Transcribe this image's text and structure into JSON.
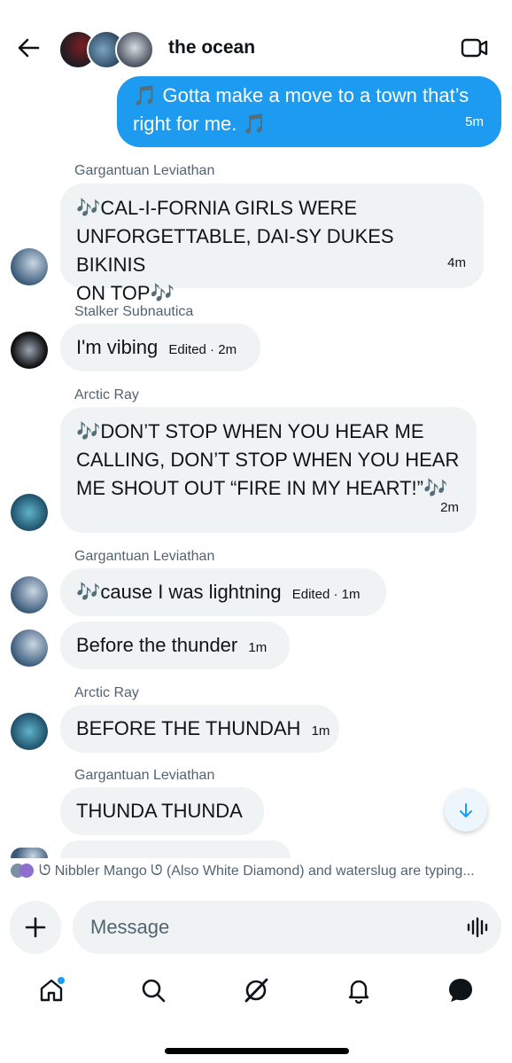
{
  "header": {
    "title": "the ocean"
  },
  "messages": [
    {
      "sender": "",
      "text": "🎵 Gotta make a move to a town that’s right for me. 🎵",
      "line1": "🎵 Gotta make a move to a town that’s",
      "line2": "right for me. 🎵",
      "time": "5m"
    },
    {
      "sender": "Gargantuan Leviathan",
      "line1": "🎶CAL-I-FORNIA GIRLS WERE",
      "line2": "UNFORGETTABLE, DAI-SY DUKES BIKINIS",
      "line3": "ON TOP🎶",
      "time": "4m"
    },
    {
      "sender": "Stalker Subnautica",
      "text": "I'm vibing",
      "time": "Edited · 2m"
    },
    {
      "sender": "Arctic Ray",
      "line1": "🎶DON’T STOP WHEN YOU HEAR ME",
      "line2": "CALLING, DON’T STOP WHEN YOU HEAR",
      "line3": "ME SHOUT OUT “FIRE IN MY HEART!”🎶",
      "time": "2m"
    },
    {
      "sender": "Gargantuan Leviathan",
      "text": "🎶cause I was lightning",
      "time": "Edited · 1m"
    },
    {
      "sender": "",
      "text": "Before the thunder",
      "time": "1m"
    },
    {
      "sender": "Arctic Ray",
      "text": "BEFORE THE THUNDAH",
      "time": "1m"
    },
    {
      "sender": "Gargantuan Leviathan",
      "text": "THUNDA THUNDA",
      "time": ""
    }
  ],
  "typing_indicator": "ᘎ Nibbler Mango ᘎ (Also White Diamond) and waterslug are typing...",
  "composer": {
    "placeholder": "Message"
  },
  "colors": {
    "accent": "#1d9bf0",
    "bubble_other": "#eff3f4",
    "secondary_text": "#536471"
  },
  "icons": [
    "back-arrow-icon",
    "video-call-icon",
    "scroll-down-icon",
    "plus-icon",
    "voice-wave-icon",
    "home-icon",
    "search-icon",
    "grok-icon",
    "bell-icon",
    "messages-icon"
  ]
}
